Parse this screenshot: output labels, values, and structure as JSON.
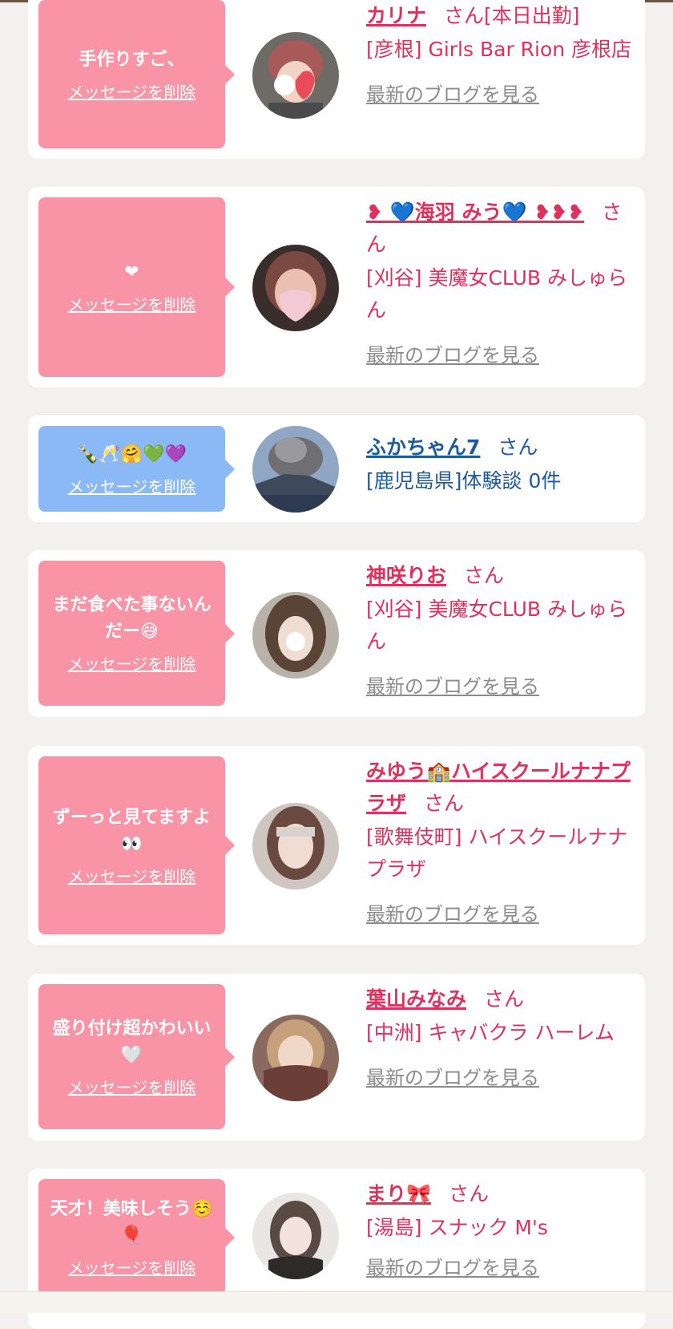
{
  "delete_label": "メッセージを削除",
  "san_label": "さん",
  "blog_label": "最新のブログを見る",
  "colors": {
    "pink_bubble": "#f993a6",
    "blue_bubble": "#8ab9f5",
    "name_pink": "#e0305e",
    "name_blue": "#1d5a9b"
  },
  "entries": [
    {
      "message": "手作りすご、",
      "name": "カリナ",
      "extra": "[本日出勤]",
      "store": "[彦根] Girls Bar Rion 彦根店",
      "has_blog": true
    },
    {
      "message": "❤",
      "name": "❥ 💙海羽 みう💙 ❥❥❥",
      "store": "[刈谷] 美魔女CLUB みしゅらん",
      "has_blog": true
    },
    {
      "message": "🍾🥂🤗💚💜",
      "name": "ふかちゃん7",
      "store": "[鹿児島県]体験談 0件",
      "has_blog": false
    },
    {
      "message": "まだ食べた事ないんだー😅",
      "name": "神咲りお",
      "store": "[刈谷] 美魔女CLUB みしゅらん",
      "has_blog": true
    },
    {
      "message": "ずーっと見てますよ👀",
      "name": "みゆう🏫ハイスクールナナプラザ",
      "store": "[歌舞伎町] ハイスクールナナプラザ",
      "has_blog": true
    },
    {
      "message": "盛り付け超かわいい🤍",
      "name": "葉山みなみ",
      "store": "[中洲] キャバクラ ハーレム",
      "has_blog": true
    },
    {
      "message": "天才！美味しそう☺️🎈",
      "name": "まり🎀",
      "store": "[湯島] スナック M's",
      "has_blog": true
    }
  ]
}
